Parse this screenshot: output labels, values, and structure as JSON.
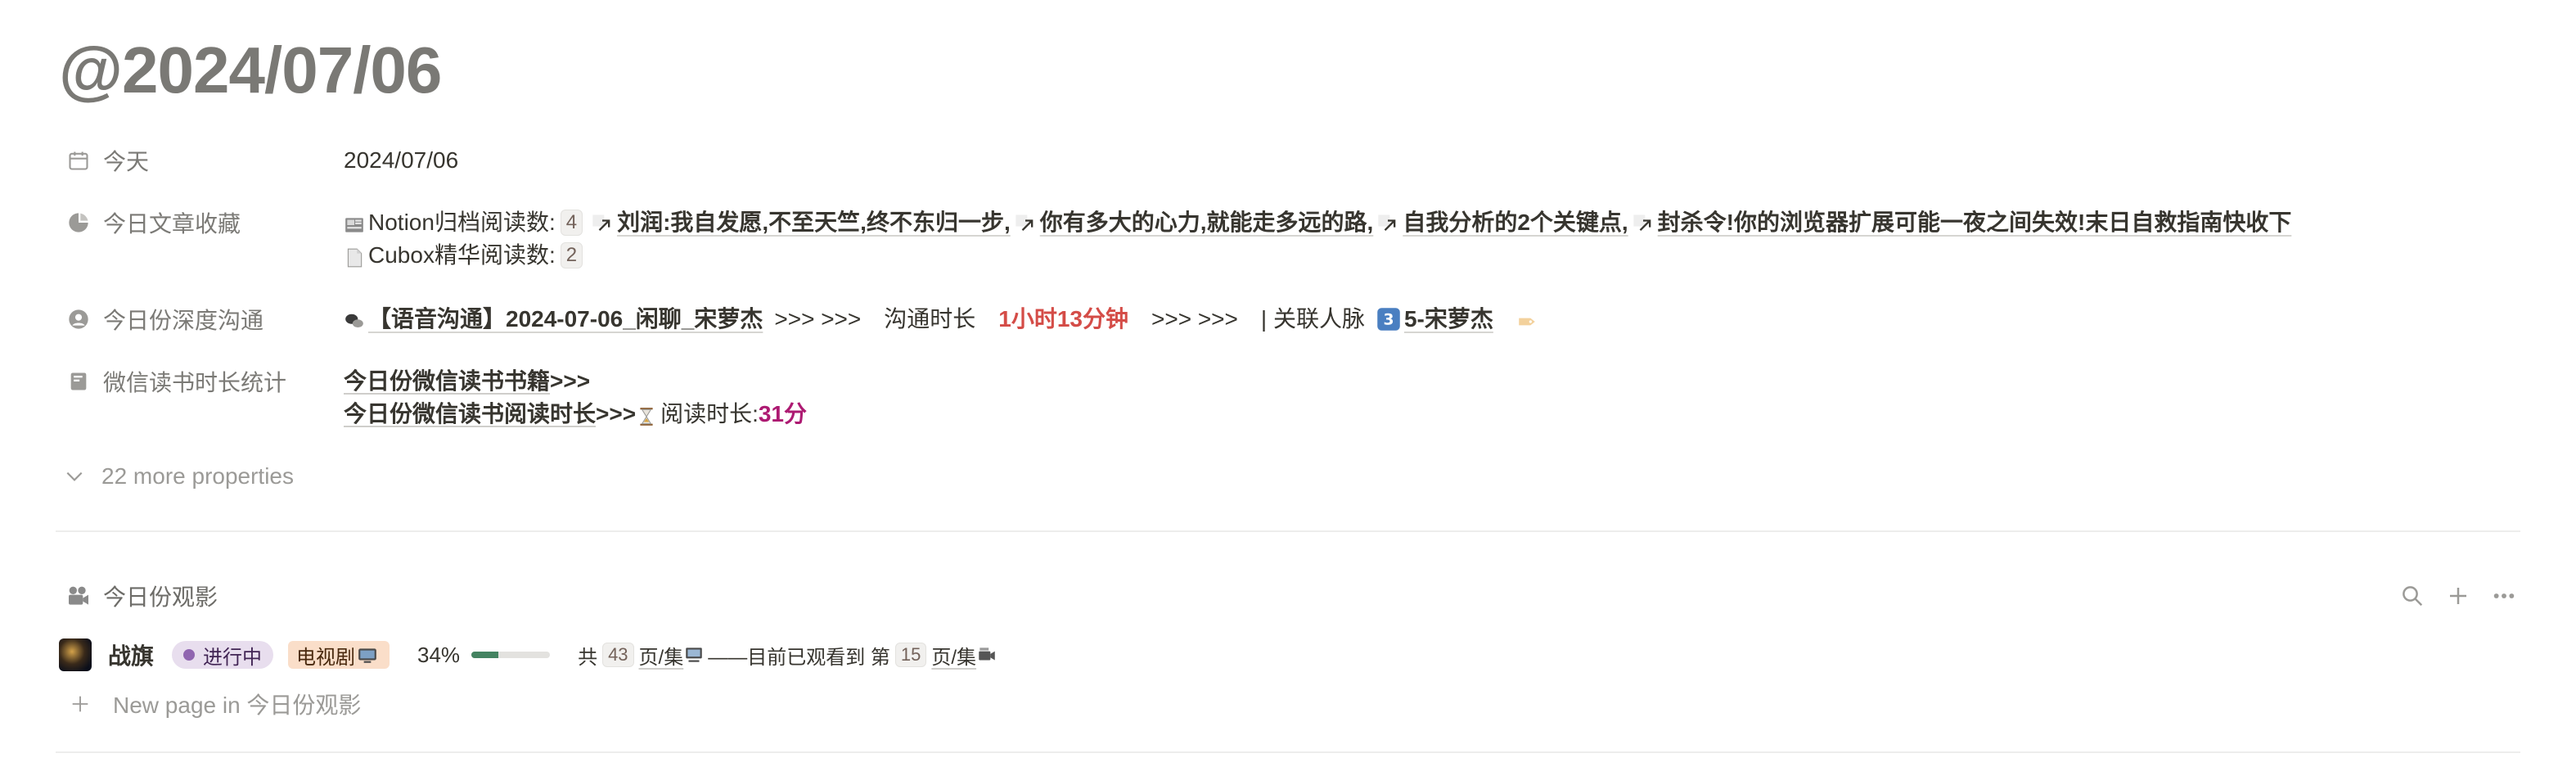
{
  "page": {
    "title": "@2024/07/06"
  },
  "properties": {
    "today": {
      "label": "今天",
      "value": "2024/07/06",
      "icon": "calendar-icon"
    },
    "saved_articles": {
      "label": "今日文章收藏",
      "icon": "pie-chart-icon",
      "notion_label": "Notion归档阅读数:",
      "notion_count": "4",
      "links": [
        "刘润:我自发愿,不至天竺,终不东归一步,",
        "你有多大的心力,就能走多远的路,",
        "自我分析的2个关键点,",
        "封杀令!你的浏览器扩展可能一夜之间失效!末日自救指南快收下"
      ],
      "cubox_label": "Cubox精华阅读数:",
      "cubox_count": "2"
    },
    "deep_talk": {
      "label": "今日份深度沟通",
      "icon": "person-circle-icon",
      "title_text": "【语音沟通】2024-07-06_闲聊_宋萝杰",
      "arrows1": ">>> >>>",
      "duration_label": "沟通时长",
      "duration_value": "1小时13分钟",
      "arrows2": ">>> >>>",
      "relation_label": "| 关联人脉",
      "relation_link": "5-宋萝杰"
    },
    "wechat_reading": {
      "label": "微信读书时长统计",
      "icon": "book-icon",
      "books_label": "今日份微信读书书籍",
      "books_arrows": ">>>",
      "time_label": "今日份微信读书阅读时长",
      "time_arrows": ">>>",
      "duration_prefix": "阅读时长:",
      "duration_value": "31分"
    }
  },
  "more_properties": "22 more properties",
  "database": {
    "title": "今日份观影",
    "icon": "film-camera-icon",
    "rows": [
      {
        "title": "战旗",
        "status": "进行中",
        "tag": "电视剧",
        "progress_text": "34%",
        "progress_fraction": 0.34,
        "total_prefix": "共",
        "total_count": "43",
        "total_suffix": "页/集",
        "watched_text": "——目前已观看到 第",
        "watched_count": "15",
        "watched_suffix": "页/集"
      }
    ],
    "new_page_label": "New page in 今日份观影"
  },
  "colors": {
    "status_purple": "#9065b0",
    "progress_green": "#448361",
    "duration_red": "#d44c47",
    "reading_pink": "#ad1a72"
  }
}
